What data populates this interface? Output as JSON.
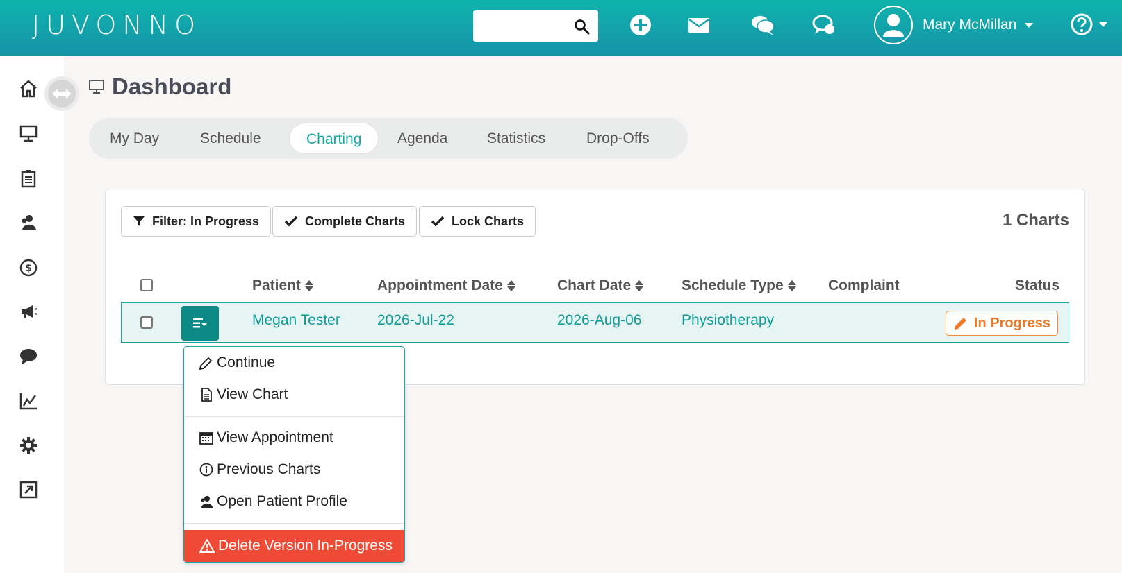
{
  "app": {
    "logo": "JUVONNO"
  },
  "header": {
    "search": {
      "placeholder": ""
    },
    "user_name": "Mary McMillan"
  },
  "page": {
    "title": "Dashboard"
  },
  "tabs": [
    {
      "label": "My Day"
    },
    {
      "label": "Schedule"
    },
    {
      "label": "Charting",
      "active": true
    },
    {
      "label": "Agenda"
    },
    {
      "label": "Statistics"
    },
    {
      "label": "Drop-Offs"
    }
  ],
  "toolbar": {
    "filter_label": "Filter: In Progress",
    "complete_label": "Complete Charts",
    "lock_label": "Lock Charts",
    "count_label": "1 Charts"
  },
  "table": {
    "columns": {
      "patient": "Patient",
      "appointment_date": "Appointment Date",
      "chart_date": "Chart Date",
      "schedule_type": "Schedule Type",
      "complaint": "Complaint",
      "status": "Status"
    },
    "rows": [
      {
        "patient": "Megan Tester",
        "appointment_date": "2026-Jul-22",
        "chart_date": "2026-Aug-06",
        "schedule_type": "Physiotherapy",
        "complaint": "",
        "status": "In Progress"
      }
    ]
  },
  "row_menu": {
    "continue": "Continue",
    "view_chart": "View Chart",
    "view_appointment": "View Appointment",
    "previous_charts": "Previous Charts",
    "open_profile": "Open Patient Profile",
    "delete": "Delete Version In-Progress"
  },
  "colors": {
    "brand": "#14aba5",
    "accent_dark": "#0e8a86",
    "status": "#f07a28",
    "danger": "#ee4a36"
  }
}
